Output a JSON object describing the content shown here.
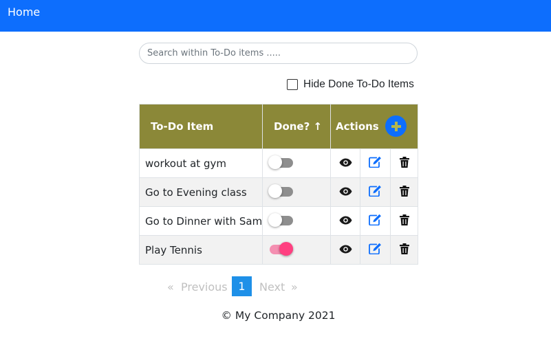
{
  "nav": {
    "home_label": "Home"
  },
  "search": {
    "placeholder": "Search within To-Do items .....",
    "value": ""
  },
  "filter": {
    "hide_done_label": "Hide Done To-Do Items",
    "checked": false
  },
  "table": {
    "headers": {
      "item": "To-Do Item",
      "done": "Done? ↑",
      "actions": "Actions"
    },
    "header_color": "#8b8838",
    "rows": [
      {
        "text": "workout at gym",
        "done": false
      },
      {
        "text": "Go to Evening class",
        "done": false
      },
      {
        "text": "Go to Dinner with Sam",
        "done": false
      },
      {
        "text": "Play Tennis",
        "done": true
      }
    ],
    "icons": {
      "add": "plus-circle-icon",
      "view": "eye-icon",
      "edit": "edit-icon",
      "delete": "trash-icon"
    }
  },
  "pagination": {
    "prev": "«",
    "prev_label": "Previous",
    "current": "1",
    "next_label": "Next",
    "next": "»"
  },
  "footer": {
    "text": "© My Company 2021"
  },
  "colors": {
    "primary": "#0d6efd",
    "toggle_on": "#ff4081",
    "edit_icon": "#0d6efd",
    "page_active": "#1e90e8"
  }
}
